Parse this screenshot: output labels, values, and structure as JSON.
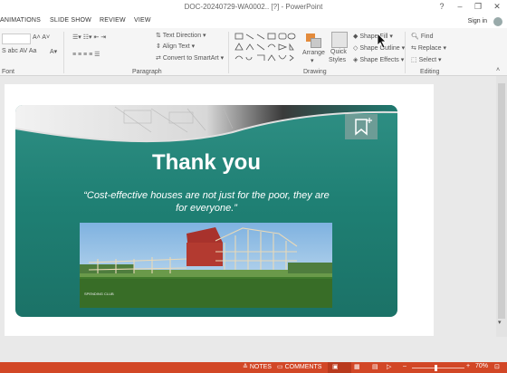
{
  "window": {
    "title": "DOC-20240729-WA0002.. [?] - PowerPoint"
  },
  "tabs": [
    {
      "label": "ANIMATIONS"
    },
    {
      "label": "SLIDE SHOW"
    },
    {
      "label": "REVIEW"
    },
    {
      "label": "VIEW"
    }
  ],
  "signin": "Sign in",
  "ribbon": {
    "groups": {
      "font": "Font",
      "paragraph": "Paragraph",
      "drawing": "Drawing",
      "editing": "Editing"
    },
    "paragraph": {
      "text_direction": "Text Direction",
      "align_text": "Align Text",
      "convert_smartart": "Convert to SmartArt"
    },
    "drawing": {
      "arrange": "Arrange",
      "quick_styles_1": "Quick",
      "quick_styles_2": "Styles",
      "shape_fill": "Shape Fill",
      "shape_outline": "Shape Outline",
      "shape_effects": "Shape Effects"
    },
    "editing": {
      "find": "Find",
      "replace": "Replace",
      "select": "Select"
    }
  },
  "slide": {
    "title": "Thank you",
    "quote_line1": "“Cost-effective houses are not just for the poor, they are",
    "quote_line2": "for everyone.”",
    "photo_credit": "SPENDING CLUB"
  },
  "status": {
    "notes": "NOTES",
    "comments": "COMMENTS",
    "zoom": "70%"
  },
  "colors": {
    "slide_teal": "#1f8074",
    "status_orange": "#d24726"
  }
}
